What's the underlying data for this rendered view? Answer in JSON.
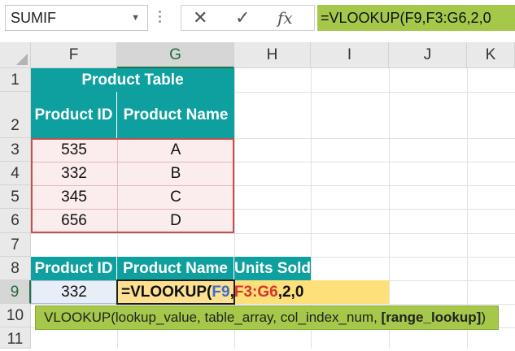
{
  "formula_bar": {
    "name_box": "SUMIF",
    "cancel_icon": "✕",
    "enter_icon": "✓",
    "fx_label": "fx",
    "formula_text": "=VLOOKUP(F9,F3:G6,2,0"
  },
  "columns": [
    "F",
    "G",
    "H",
    "I",
    "J",
    "K"
  ],
  "rows": [
    "1",
    "2",
    "3",
    "4",
    "5",
    "6",
    "7",
    "8",
    "9",
    "10",
    "11"
  ],
  "product_table": {
    "title": "Product Table",
    "header_id": "Product ID",
    "header_name": "Product Name",
    "rows": [
      {
        "id": "535",
        "name": "A"
      },
      {
        "id": "332",
        "name": "B"
      },
      {
        "id": "345",
        "name": "C"
      },
      {
        "id": "656",
        "name": "D"
      }
    ]
  },
  "lookup_table": {
    "header_id": "Product ID",
    "header_name": "Product Name",
    "header_units": "Units Sold",
    "id_value": "332",
    "formula_parts": {
      "prefix": "=VLOOKUP(",
      "ref1": "F9",
      "comma1": ",",
      "ref2": "F3:G6",
      "suffix": ",2,0"
    }
  },
  "tooltip": {
    "main": "VLOOKUP(lookup_value, table_array, col_index_num, ",
    "optional": "[range_lookup]",
    "close": ")"
  },
  "colors": {
    "teal_header": "#0e9f9f",
    "formula_green": "#a5c84a",
    "active_cell_fill": "#fde090",
    "table_outline": "#c1504f"
  }
}
